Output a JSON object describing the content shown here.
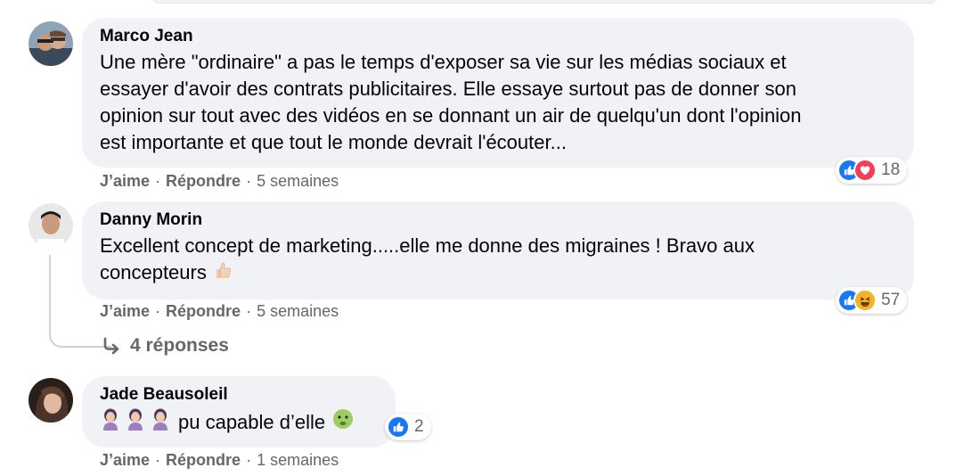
{
  "comments": [
    {
      "author": "Marco Jean",
      "lines": [
        "Une mère \"ordinaire\" a pas le temps d'exposer sa vie sur les médias sociaux et",
        "essayer d'avoir des contrats publicitaires. Elle essaye surtout pas de donner son",
        "opinion sur tout avec des vidéos en se donnant un air de quelqu'un dont l'opinion",
        "est importante et que tout le monde devrait l'écouter..."
      ],
      "like_label": "J’aime",
      "reply_label": "Répondre",
      "separator": "·",
      "time": "5 semaines",
      "reaction_icons": [
        "like-icon",
        "love-icon"
      ],
      "reaction_count": "18"
    },
    {
      "author": "Danny Morin",
      "line1": "Excellent concept de marketing.....elle me donne des migraines ! Bravo aux",
      "line2": "concepteurs",
      "line2_emoji": "thumbs-up-emoji",
      "like_label": "J’aime",
      "reply_label": "Répondre",
      "separator": "·",
      "time": "5 semaines",
      "reaction_icons": [
        "like-icon",
        "haha-icon"
      ],
      "reaction_count": "57",
      "replies_label": "4 réponses",
      "replies_icon": "reply-arrow-icon"
    },
    {
      "author": "Jade Beausoleil",
      "text": "pu capable d’elle",
      "leading_emojis": [
        "woman-facepalming-emoji",
        "woman-facepalming-emoji",
        "woman-facepalming-emoji"
      ],
      "trailing_emoji": "nauseated-face-emoji",
      "like_label": "J’aime",
      "reply_label": "Répondre",
      "separator": "·",
      "time": "1 semaines",
      "reaction_icons": [
        "like-icon"
      ],
      "reaction_count": "2"
    }
  ],
  "colors": {
    "bubble": "#f0f2f5",
    "meta_text": "#65676b",
    "like_blue": "#1877f2",
    "love_red": "#f33e58",
    "haha_yellow": "#f7b125"
  }
}
